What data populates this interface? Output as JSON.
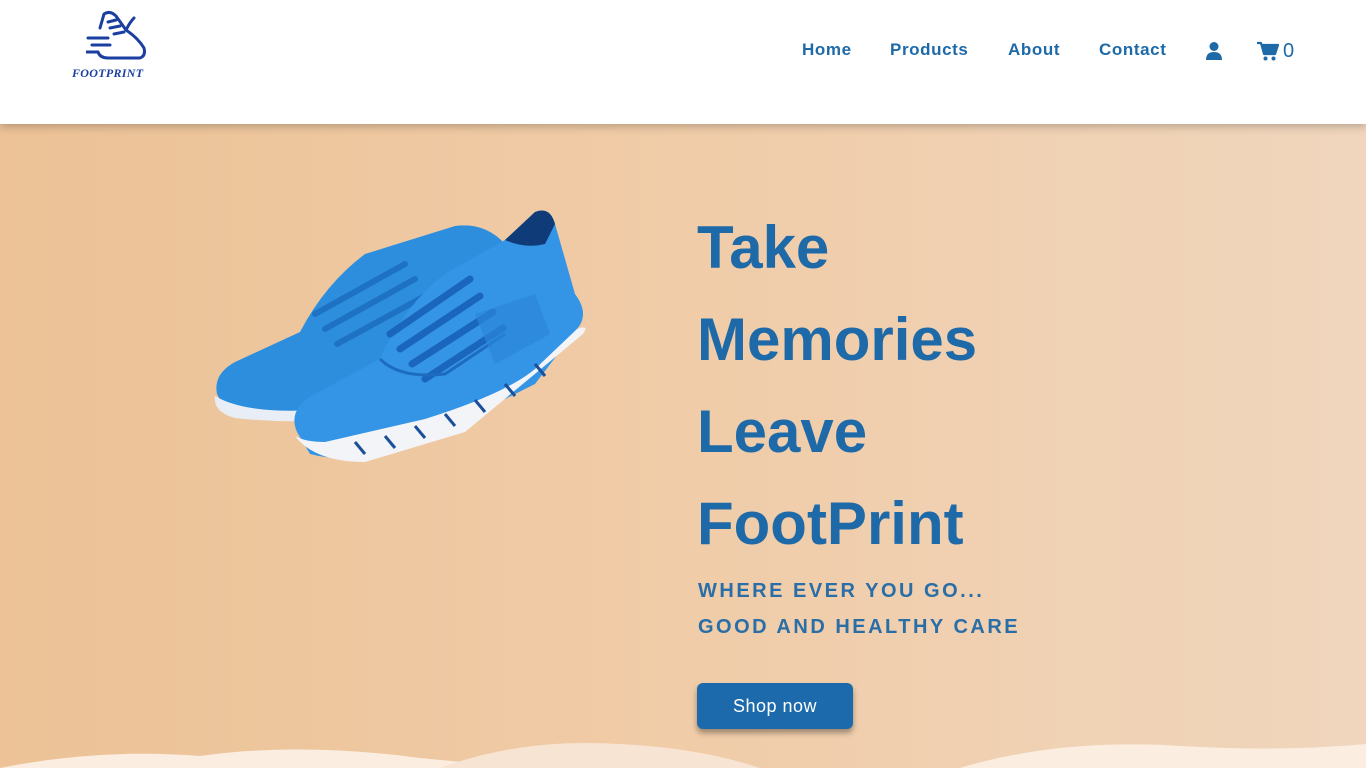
{
  "brand": {
    "name": "FOOTPRINT",
    "color": "#1b3fa0"
  },
  "nav": {
    "links": [
      "Home",
      "Products",
      "About",
      "Contact"
    ],
    "account_icon": "user-icon",
    "cart_icon": "shopping-cart-icon",
    "cart_count": "0",
    "color": "#1e6aa8"
  },
  "hero": {
    "headline": [
      "Take",
      "Memories",
      "Leave",
      "FootPrint"
    ],
    "tagline_1": "WHERE EVER YOU GO...",
    "tagline_2": "GOOD AND HEALTHY CARE",
    "cta_label": "Shop now",
    "image": "blue-running-shoes",
    "accent": "#1c6aab",
    "background": [
      "#ecc296",
      "#f0d6bd"
    ]
  }
}
